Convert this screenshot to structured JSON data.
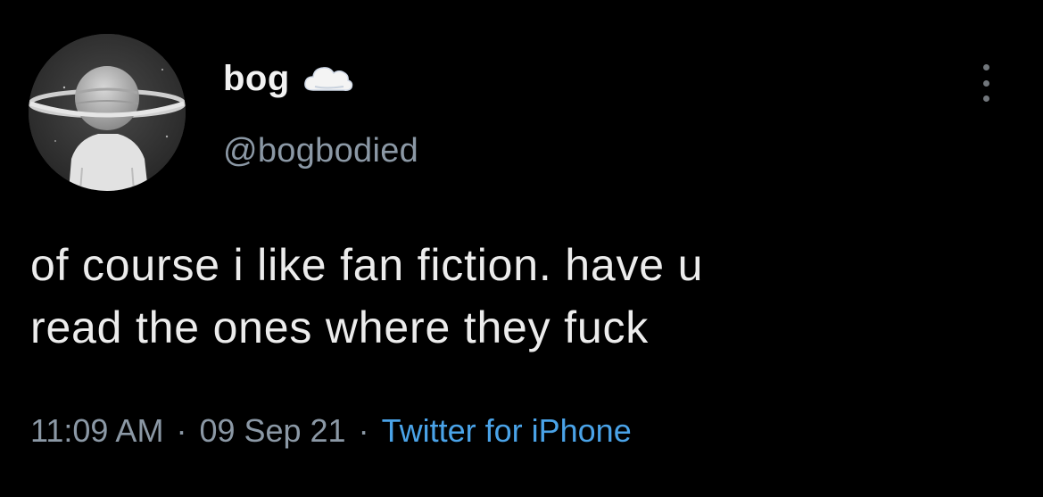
{
  "user": {
    "display_name": "bog",
    "handle": "@bogbodied",
    "name_icon": "cloud-icon",
    "avatar_icon": "saturn-head-avatar"
  },
  "tweet": {
    "text": "of course i like fan fiction. have u\nread the ones where they fuck",
    "time": "11:09 AM",
    "date": "09 Sep 21",
    "source": "Twitter for iPhone",
    "separator": "·"
  },
  "menu": {
    "icon": "more-vertical-icon"
  },
  "colors": {
    "background": "#000000",
    "text": "#e7e9ea",
    "secondary": "#8b98a5",
    "link": "#4aa3e8"
  }
}
